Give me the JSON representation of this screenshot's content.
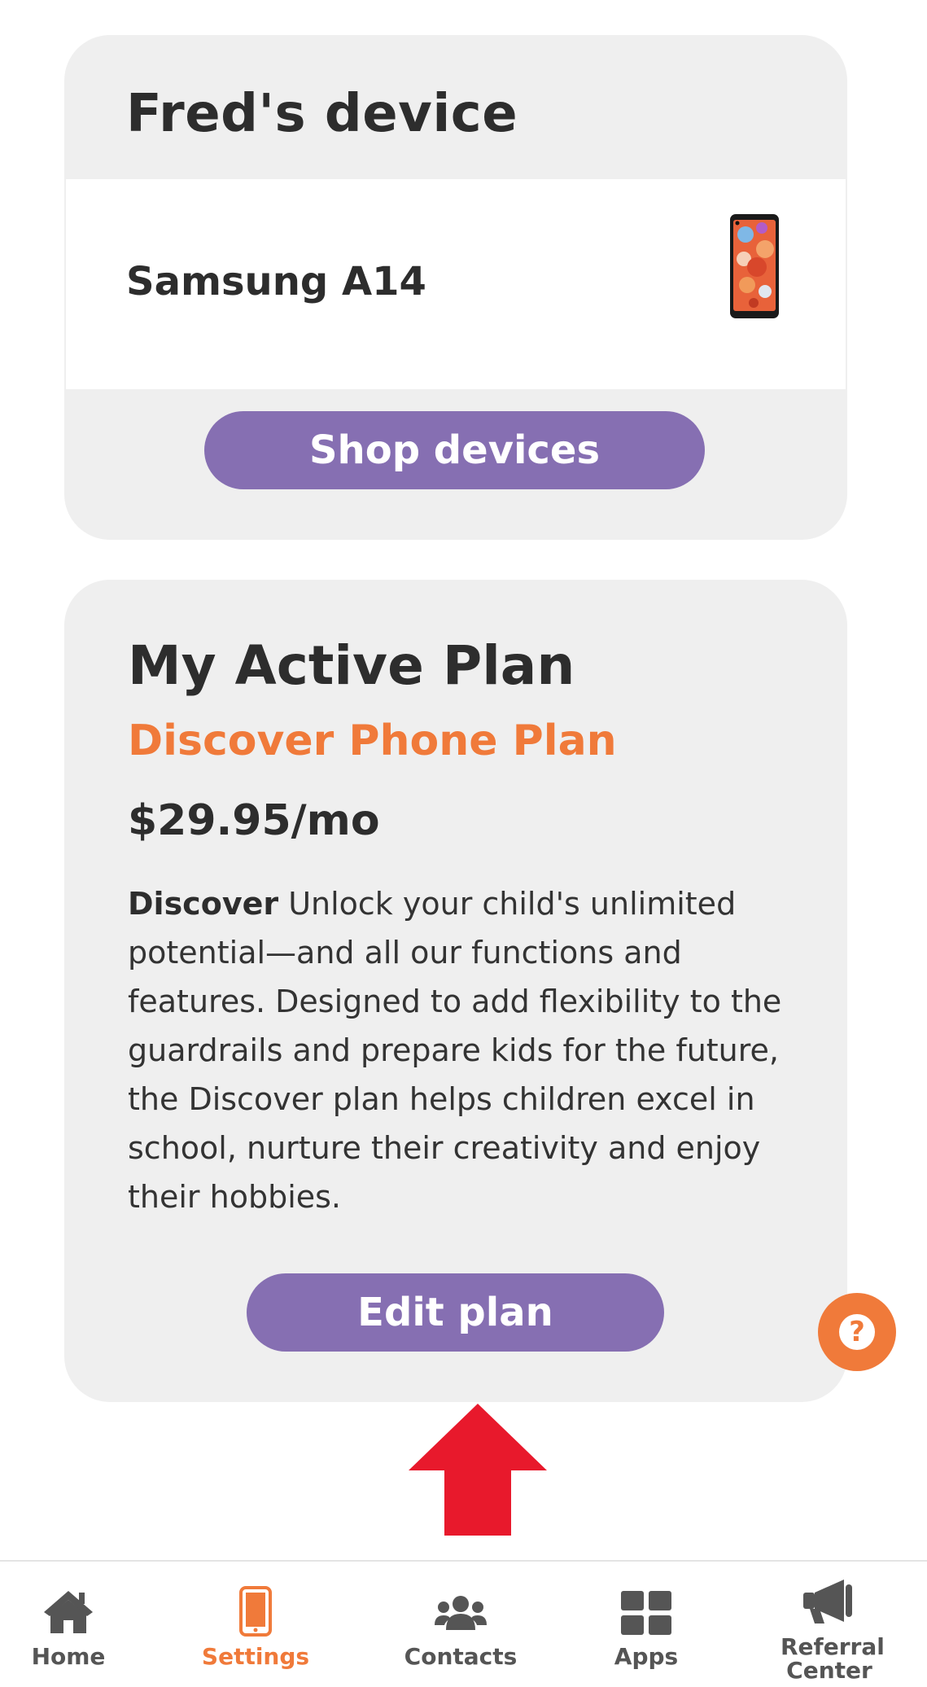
{
  "device_card": {
    "title": "Fred's device",
    "device_name": "Samsung A14",
    "shop_button": "Shop devices"
  },
  "plan_card": {
    "heading": "My Active Plan",
    "plan_name": "Discover Phone Plan",
    "price": "$29.95/mo",
    "description_bold": "Discover",
    "description": " Unlock your child's unlimited potential—and all our functions and features. Designed to add flexibility to the guardrails and prepare kids for the future, the Discover plan helps children excel in school, nurture their creativity and enjoy their hobbies.",
    "edit_button": "Edit plan"
  },
  "help": {
    "icon": "question-mark-icon",
    "glyph": "?"
  },
  "annotation": {
    "icon": "red-up-arrow"
  },
  "bottom_nav": {
    "active": "Settings",
    "items": [
      {
        "label": "Home",
        "icon": "home-icon"
      },
      {
        "label": "Settings",
        "icon": "phone-icon"
      },
      {
        "label": "Contacts",
        "icon": "users-icon"
      },
      {
        "label": "Apps",
        "icon": "grid-icon"
      },
      {
        "label": "Referral Center",
        "icon": "megaphone-icon"
      }
    ]
  },
  "colors": {
    "accent_purple": "#866fb2",
    "accent_orange": "#f07a3a",
    "card_bg": "#efefef",
    "arrow_red": "#e8192c"
  }
}
